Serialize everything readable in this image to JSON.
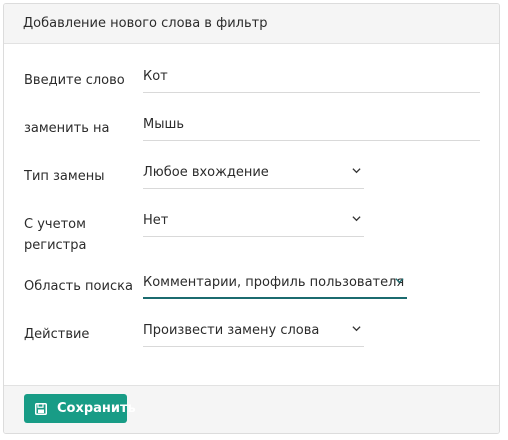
{
  "header": {
    "title": "Добавление нового слова в фильтр"
  },
  "form": {
    "word": {
      "label": "Введите слово",
      "value": "Кот"
    },
    "replace": {
      "label": "заменить на",
      "value": "Мышь"
    },
    "type": {
      "label": "Тип замены",
      "value": "Любое вхождение"
    },
    "case": {
      "label_line1": "С учетом",
      "label_line2": "регистра",
      "value": "Нет"
    },
    "scope": {
      "label": "Область поиска",
      "value": "Комментарии, профиль пользователя"
    },
    "action": {
      "label": "Действие",
      "value": "Произвести замену слова"
    }
  },
  "footer": {
    "save_label": "Сохранить",
    "save_icon": "floppy-disk-icon"
  },
  "colors": {
    "accent": "#189c86",
    "active_underline": "#1b6b6f"
  }
}
